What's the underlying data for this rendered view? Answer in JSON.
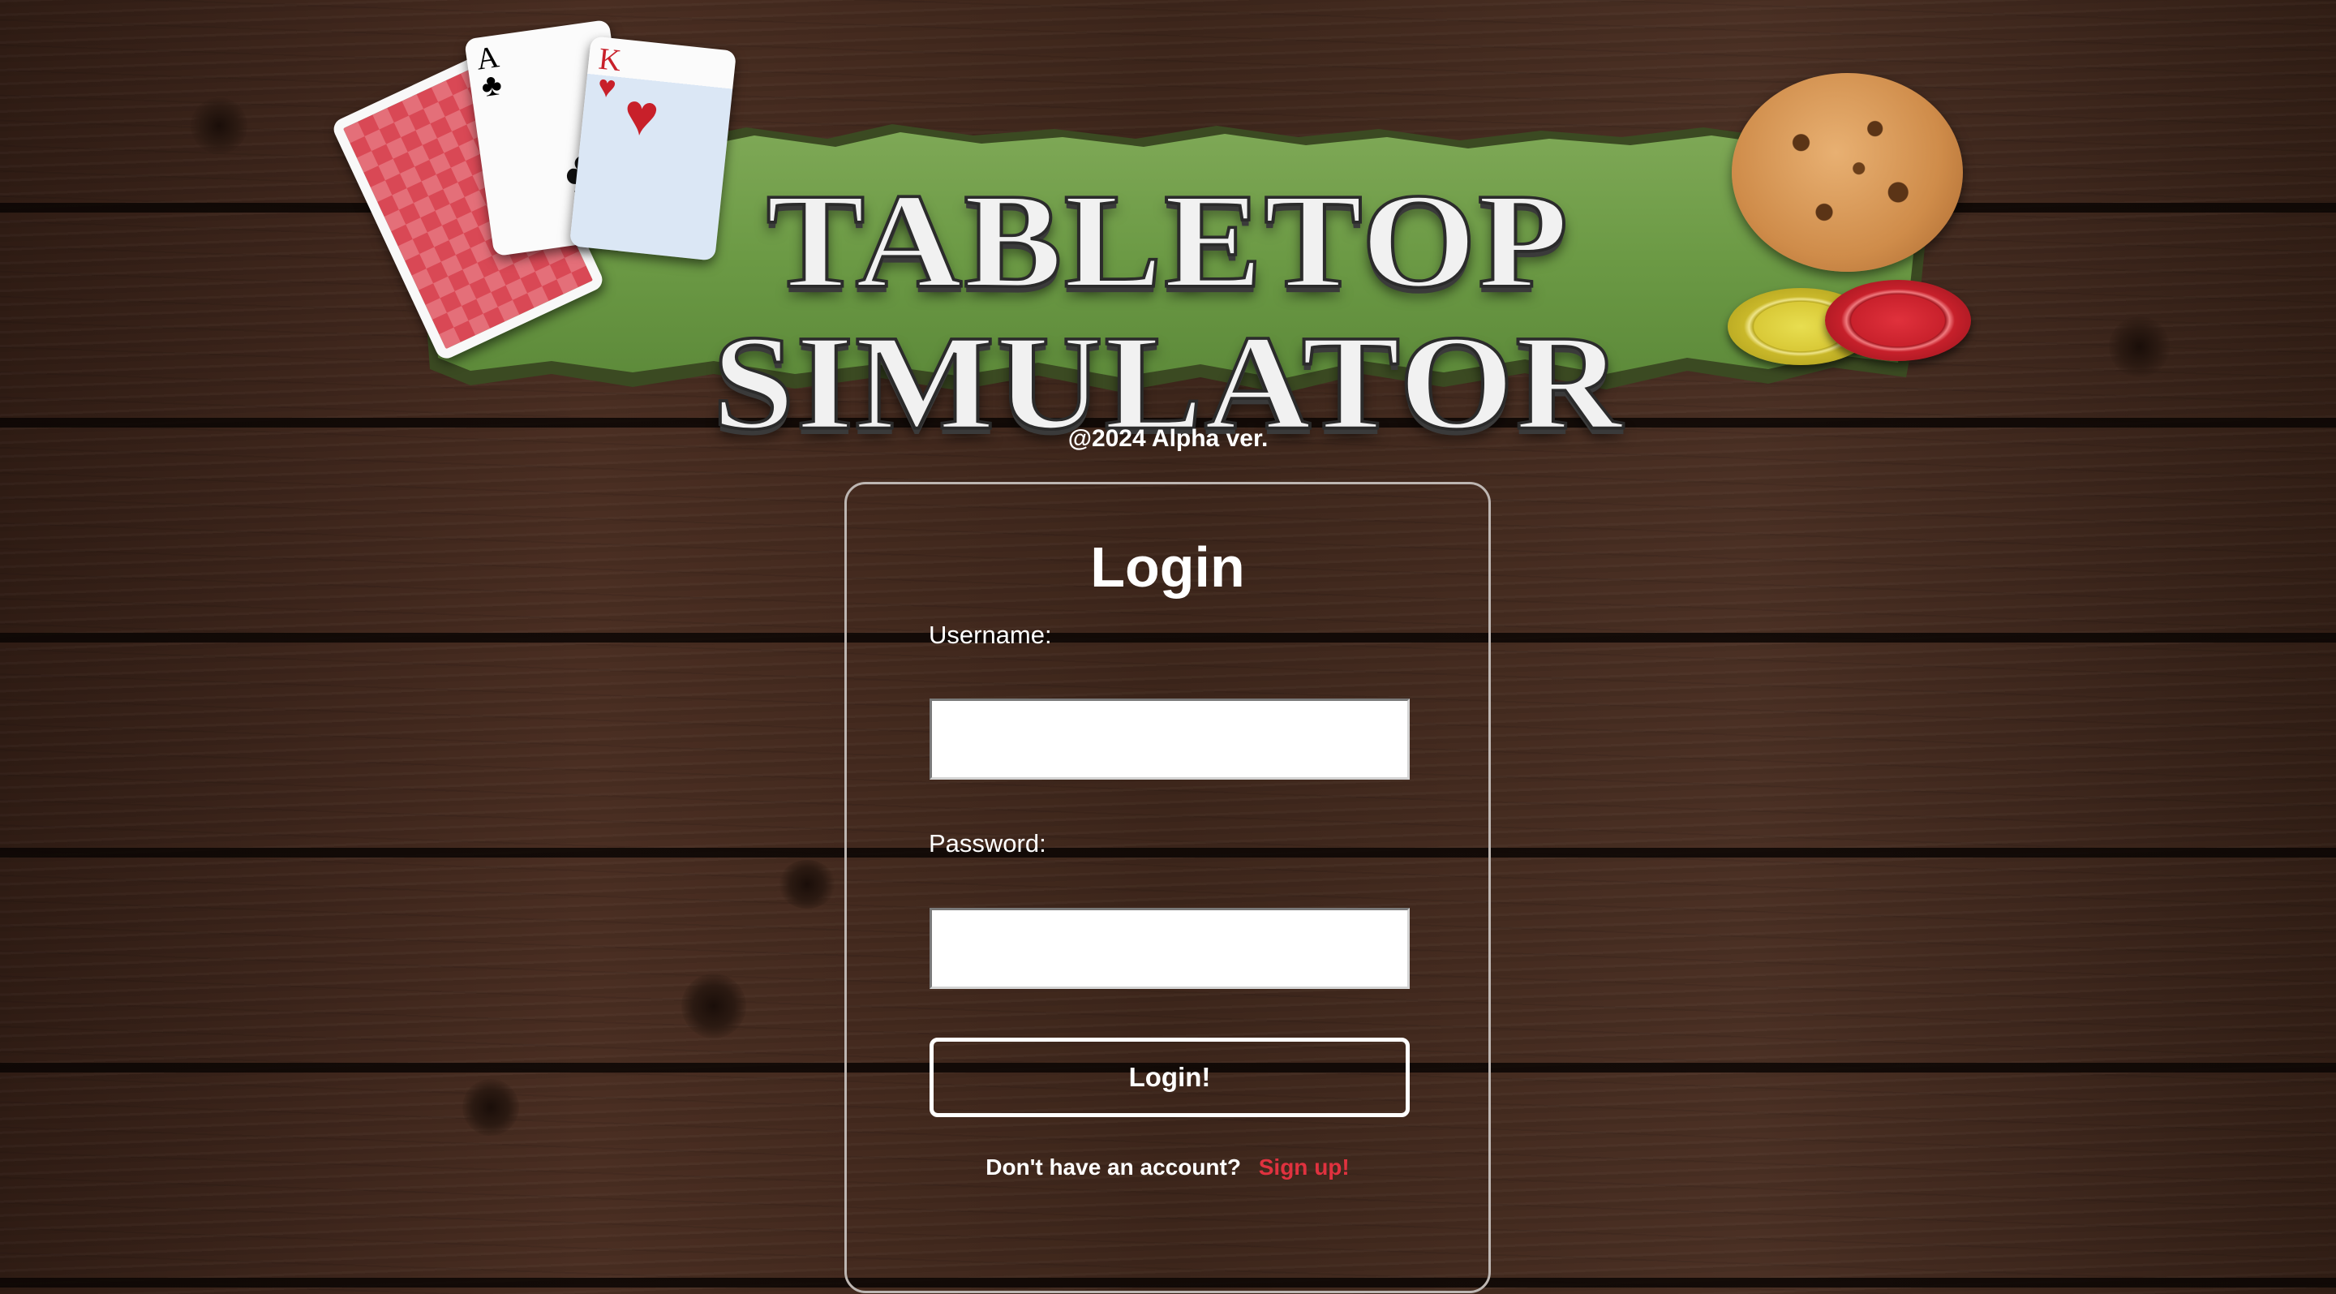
{
  "logo": {
    "title": "TABLETOP SIMULATOR",
    "card_ace": {
      "rank": "A",
      "suit": "♣"
    },
    "card_king": {
      "rank": "K",
      "suit": "♥"
    }
  },
  "version": "@2024 Alpha ver.",
  "login": {
    "title": "Login",
    "username_label": "Username:",
    "username_value": "",
    "password_label": "Password:",
    "password_value": "",
    "submit_label": "Login!",
    "no_account_text": "Don't have an account?",
    "signup_link": "Sign up!"
  },
  "colors": {
    "wood": "#3b241a",
    "banner_green": "#6e9a47",
    "link_red": "#e0323f",
    "card_border": "#bdb6b2"
  }
}
